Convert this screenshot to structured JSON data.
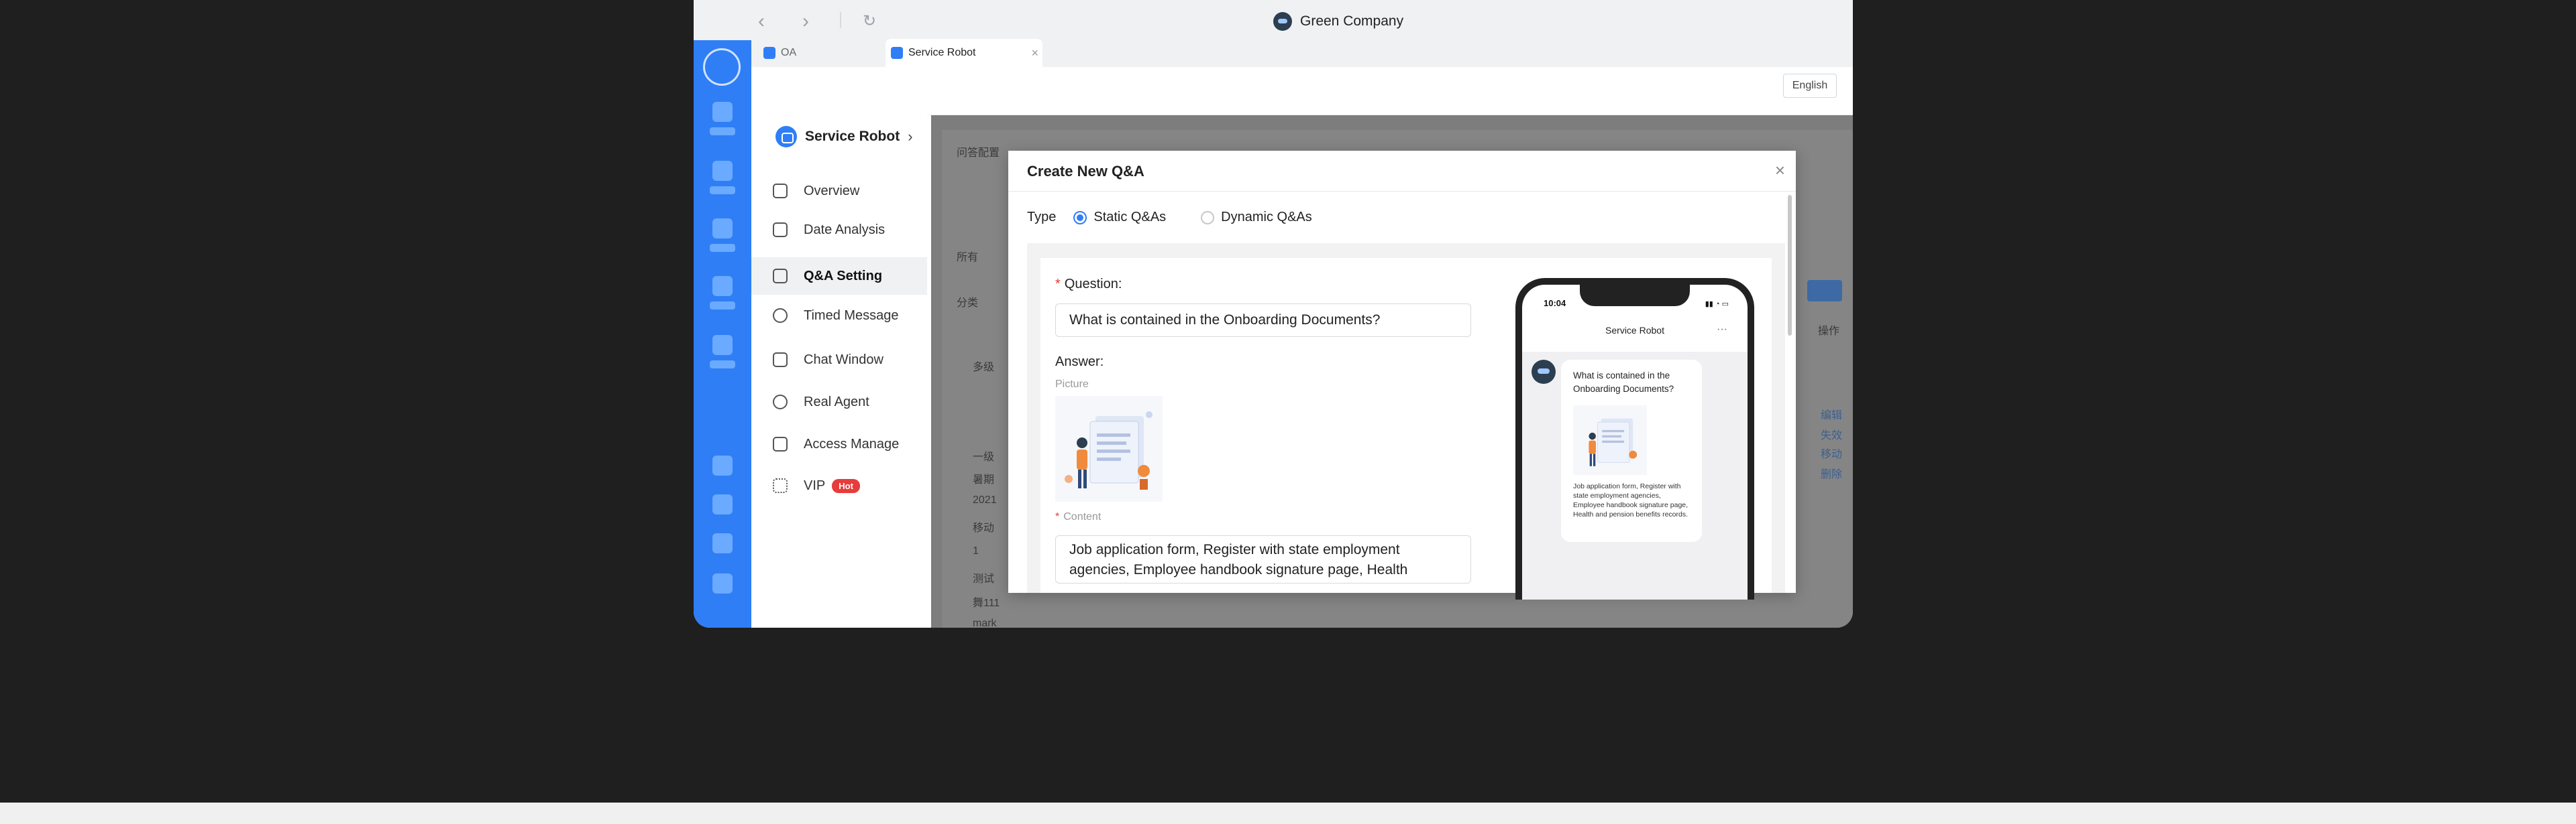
{
  "app": {
    "title": "Green Company",
    "logo_icon": "robot-logo-icon"
  },
  "tabs": [
    {
      "label": "OA"
    },
    {
      "label": "Service Robot"
    }
  ],
  "topbar": {
    "language": "English"
  },
  "sidebar": {
    "header": "Service Robot",
    "items": [
      {
        "label": "Overview",
        "icon": "home-icon"
      },
      {
        "label": "Date Analysis",
        "icon": "analytics-icon"
      },
      {
        "label": "Q&A Setting",
        "icon": "qa-icon"
      },
      {
        "label": "Timed Message",
        "icon": "clock-icon"
      },
      {
        "label": "Chat Window",
        "icon": "window-icon"
      },
      {
        "label": "Real Agent",
        "icon": "agent-icon"
      },
      {
        "label": "Access Manage",
        "icon": "lock-icon"
      },
      {
        "label": "VIP",
        "icon": "grid-icon",
        "badge": "Hot"
      }
    ]
  },
  "background_page": {
    "title": "问答配置",
    "filter_label": "所有",
    "category_label": "分类",
    "actions_header": "操作",
    "tree_items": [
      "多级",
      "一级",
      "暑期",
      "2021",
      "移动",
      "1",
      "测试",
      "舞111",
      "mark"
    ],
    "row_actions": [
      "编辑",
      "失效",
      "移动",
      "删除"
    ]
  },
  "modal": {
    "title": "Create New Q&A",
    "type_label": "Type",
    "type_options": [
      "Static Q&As",
      "Dynamic Q&As"
    ],
    "selected_type": "Static Q&As",
    "question_label": "Question:",
    "question_value": "What is contained in the Onboarding Documents?",
    "answer_label": "Answer:",
    "picture_label": "Picture",
    "content_label": "Content",
    "content_value": "Job application form, Register with state employment agencies, Employee handbook signature page, Health"
  },
  "preview": {
    "time": "10:04",
    "header": "Service Robot",
    "question": "What is contained in the Onboarding Documents?",
    "answer": "Job application form, Register with state employment agencies, Employee handbook signature page, Health and pension benefits records."
  },
  "colors": {
    "accent": "#2f7ef6",
    "required": "#e53935",
    "hot_badge": "#e83b3b"
  }
}
